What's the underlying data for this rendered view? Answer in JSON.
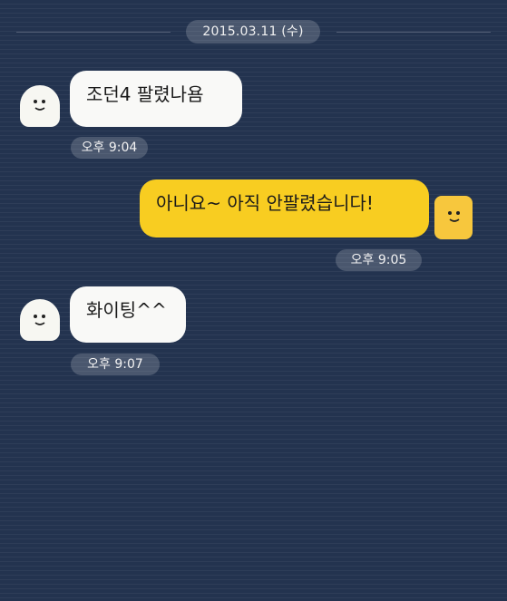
{
  "date_label": "2015.03.11 (수)",
  "messages": [
    {
      "side": "incoming",
      "text": "조던4 팔렸나욤",
      "time": "오후 9:04"
    },
    {
      "side": "outgoing",
      "text": "아니요~ 아직 안팔렸습니다!",
      "time": "오후 9:05"
    },
    {
      "side": "incoming",
      "text": "화이팅^^",
      "time": "오후 9:07"
    }
  ],
  "colors": {
    "background": "#23334f",
    "incoming_bubble": "#f9f9f7",
    "outgoing_bubble": "#f8cd21",
    "yellow_avatar": "#f7c73d"
  },
  "icons": {
    "incoming_avatar": "ghost-avatar-icon",
    "outgoing_avatar": "yellow-square-avatar-icon"
  }
}
